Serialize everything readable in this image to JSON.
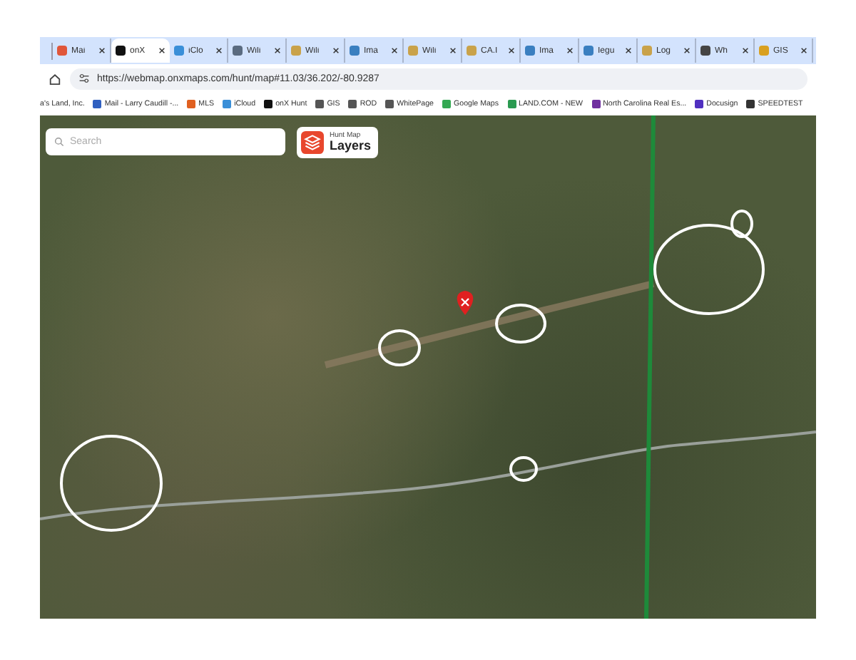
{
  "browser": {
    "tabs": [
      {
        "label": "Mai",
        "selected": false
      },
      {
        "label": "onX",
        "selected": true
      },
      {
        "label": "iClo",
        "selected": false
      },
      {
        "label": "Wili",
        "selected": false
      },
      {
        "label": "Wili",
        "selected": false
      },
      {
        "label": "Ima",
        "selected": false
      },
      {
        "label": "Wili",
        "selected": false
      },
      {
        "label": "CA.I",
        "selected": false
      },
      {
        "label": "Ima",
        "selected": false
      },
      {
        "label": "Iegu",
        "selected": false
      },
      {
        "label": "Log",
        "selected": false
      },
      {
        "label": "Wh",
        "selected": false
      },
      {
        "label": "GIS",
        "selected": false
      }
    ],
    "address_bar": {
      "url": "https://webmap.onxmaps.com/hunt/map#11.03/36.202/-80.9287"
    },
    "bookmarks": [
      "a's Land, Inc.",
      "Mail - Larry Caudill -...",
      "MLS",
      "iCloud",
      "onX Hunt",
      "GIS",
      "ROD",
      "WhitePage",
      "Google Maps",
      "LAND.COM - NEW",
      "North Carolina Real Es...",
      "Docusign",
      "SPEEDTEST"
    ]
  },
  "map": {
    "search": {
      "placeholder": "Search"
    },
    "layers_button": {
      "caption": "Hunt Map",
      "label": "Layers"
    }
  }
}
